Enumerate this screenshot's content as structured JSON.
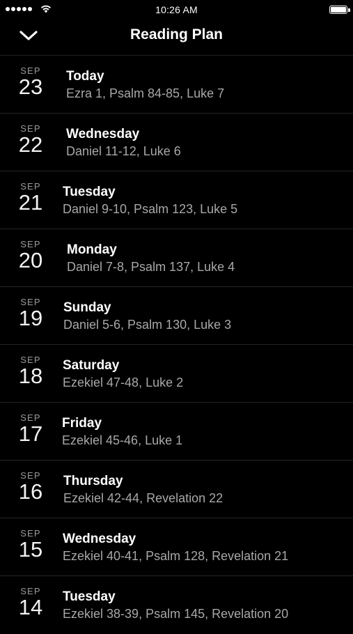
{
  "status_bar": {
    "time": "10:26 AM",
    "signal_icon": "signal-dots-icon",
    "wifi_icon": "wifi-icon",
    "battery_icon": "battery-icon",
    "battery_level": 1.0
  },
  "nav": {
    "title": "Reading Plan",
    "close_icon": "chevron-down-icon"
  },
  "entries": [
    {
      "month": "SEP",
      "day": "23",
      "weekday": "Today",
      "readings": "Ezra 1, Psalm 84-85, Luke 7"
    },
    {
      "month": "SEP",
      "day": "22",
      "weekday": "Wednesday",
      "readings": "Daniel 11-12, Luke 6"
    },
    {
      "month": "SEP",
      "day": "21",
      "weekday": "Tuesday",
      "readings": "Daniel 9-10, Psalm 123, Luke 5"
    },
    {
      "month": "SEP",
      "day": "20",
      "weekday": "Monday",
      "readings": "Daniel 7-8, Psalm 137, Luke 4"
    },
    {
      "month": "SEP",
      "day": "19",
      "weekday": "Sunday",
      "readings": "Daniel 5-6, Psalm 130, Luke 3"
    },
    {
      "month": "SEP",
      "day": "18",
      "weekday": "Saturday",
      "readings": "Ezekiel 47-48, Luke 2"
    },
    {
      "month": "SEP",
      "day": "17",
      "weekday": "Friday",
      "readings": "Ezekiel 45-46, Luke 1"
    },
    {
      "month": "SEP",
      "day": "16",
      "weekday": "Thursday",
      "readings": "Ezekiel 42-44, Revelation 22"
    },
    {
      "month": "SEP",
      "day": "15",
      "weekday": "Wednesday",
      "readings": "Ezekiel 40-41, Psalm 128, Revelation 21"
    },
    {
      "month": "SEP",
      "day": "14",
      "weekday": "Tuesday",
      "readings": "Ezekiel 38-39, Psalm 145, Revelation 20"
    }
  ]
}
